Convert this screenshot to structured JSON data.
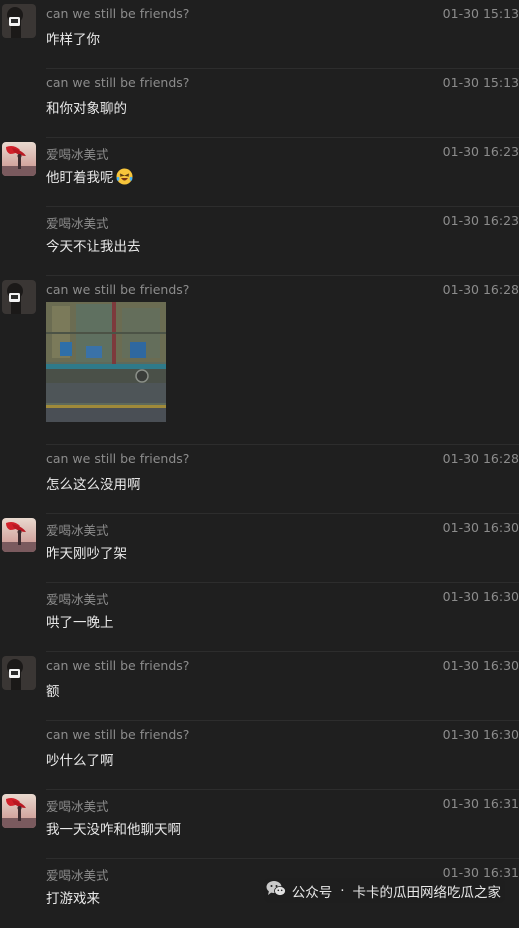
{
  "messages": [
    {
      "sender": "can we still be friends?",
      "time": "01-30 15:13",
      "text": "咋样了你",
      "avatar": "friend"
    },
    {
      "sender": "can we still be friends?",
      "time": "01-30 15:13",
      "text": "和你对象聊的"
    },
    {
      "sender": "爱喝冰美式",
      "time": "01-30 16:23",
      "text": "他盯着我呢",
      "avatar": "me",
      "emoji": "crying-laughing-emoji"
    },
    {
      "sender": "爱喝冰美式",
      "time": "01-30 16:23",
      "text": "今天不让我出去"
    },
    {
      "sender": "can we still be friends?",
      "time": "01-30 16:28",
      "avatar": "friend",
      "image": "photo-thumbnail"
    },
    {
      "sender": "can we still be friends?",
      "time": "01-30 16:28",
      "text": "怎么这么没用啊"
    },
    {
      "sender": "爱喝冰美式",
      "time": "01-30 16:30",
      "text": "昨天刚吵了架",
      "avatar": "me"
    },
    {
      "sender": "爱喝冰美式",
      "time": "01-30 16:30",
      "text": "哄了一晚上"
    },
    {
      "sender": "can we still be friends?",
      "time": "01-30 16:30",
      "text": "额",
      "avatar": "friend"
    },
    {
      "sender": "can we still be friends?",
      "time": "01-30 16:30",
      "text": "吵什么了啊"
    },
    {
      "sender": "爱喝冰美式",
      "time": "01-30 16:31",
      "text": "我一天没咋和他聊天啊",
      "avatar": "me"
    },
    {
      "sender": "爱喝冰美式",
      "time": "01-30 16:31",
      "text": "打游戏来"
    }
  ],
  "watermark": {
    "icon": "wechat-icon",
    "source": "公众号",
    "separator": "·",
    "name": "卡卡的瓜田网络吃瓜之家"
  },
  "colors": {
    "background": "#1f1f1f",
    "meta_text": "#8c8c8c",
    "message_text": "#e8e8e8",
    "divider": "#2d2d2d"
  }
}
